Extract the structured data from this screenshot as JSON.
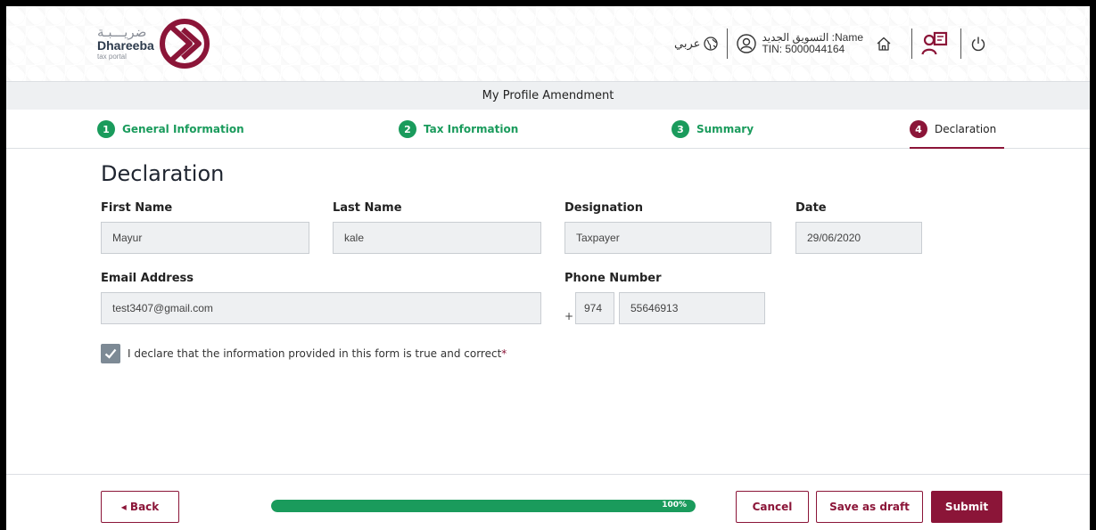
{
  "header": {
    "logo_ar": "ضريـــبـة",
    "logo_en": "Dhareeba",
    "logo_sub": "tax portal",
    "language_toggle": "عربي",
    "user_name_line": "التسويق الجديد :Name",
    "user_tin_line": "TIN: 5000044164"
  },
  "page": {
    "title": "My Profile Amendment",
    "heading": "Declaration"
  },
  "steps": [
    {
      "number": "1",
      "label": "General Information",
      "state": "done"
    },
    {
      "number": "2",
      "label": "Tax Information",
      "state": "done"
    },
    {
      "number": "3",
      "label": "Summary",
      "state": "done"
    },
    {
      "number": "4",
      "label": "Declaration",
      "state": "active"
    }
  ],
  "form": {
    "first_name_label": "First Name",
    "first_name_value": "Mayur",
    "last_name_label": "Last Name",
    "last_name_value": "kale",
    "designation_label": "Designation",
    "designation_value": "Taxpayer",
    "date_label": "Date",
    "date_value": "29/06/2020",
    "email_label": "Email Address",
    "email_value": "test3407@gmail.com",
    "phone_label": "Phone Number",
    "phone_prefix": "+",
    "phone_code": "974",
    "phone_number": "55646913",
    "declaration_text": "I declare that the information provided in this form is true and correct",
    "declaration_required": "*",
    "declaration_checked": true
  },
  "footer": {
    "back_label": "◂  Back",
    "progress_percent": 100,
    "progress_label": "100%",
    "cancel_label": "Cancel",
    "save_draft_label": "Save as draft",
    "submit_label": "Submit"
  },
  "colors": {
    "brand": "#8b1538",
    "success": "#1a9b5c",
    "field_bg": "#eef0f2"
  }
}
